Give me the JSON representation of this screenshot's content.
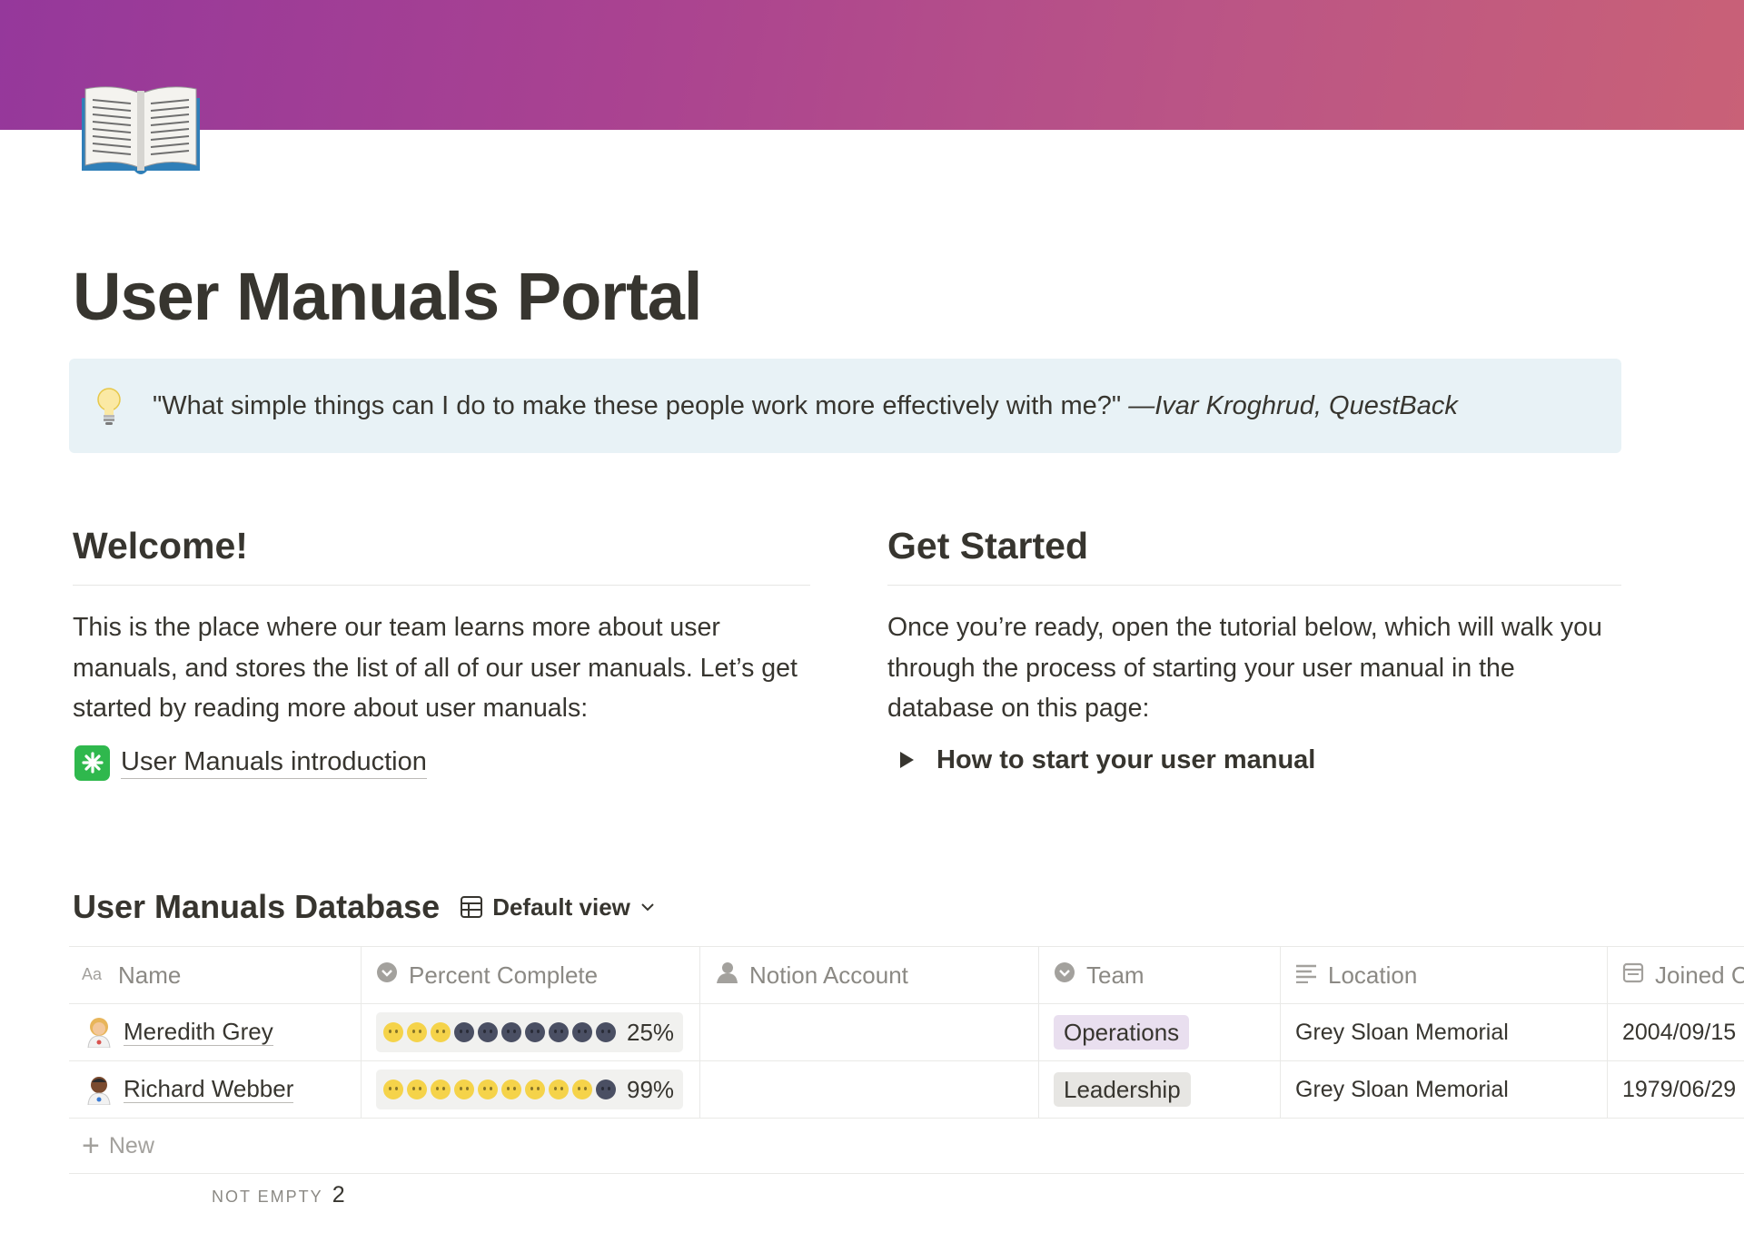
{
  "page": {
    "title": "User Manuals Portal",
    "icon": "open-book-icon"
  },
  "callout": {
    "icon": "light-bulb-icon",
    "quote": "\"What simple things can I do to make these people work more effectively with me?\" ",
    "attribution": "—Ivar Kroghrud, QuestBack"
  },
  "welcome": {
    "heading": "Welcome!",
    "body": "This is the place where our team learns more about user manuals, and stores the list of all of our user manuals. Let’s get started by reading more about user manuals:",
    "link_label": "User Manuals introduction",
    "link_icon": "eight-spoked-asterisk-icon"
  },
  "get_started": {
    "heading": "Get Started",
    "body": "Once you’re ready, open the tutorial below, which will walk you through the process of starting your user manual in the database on this page:",
    "toggle_label": "How to start your user manual"
  },
  "database": {
    "title": "User Manuals Database",
    "view_label": "Default view",
    "columns": [
      "Name",
      "Percent Complete",
      "Notion Account",
      "Team",
      "Location",
      "Joined C"
    ],
    "rows": [
      {
        "name": "Meredith Grey",
        "avatar": "woman-health-worker-icon",
        "progress": 0.25,
        "percent_label": "25%",
        "notion_account": "",
        "team": "Operations",
        "location": "Grey Sloan Memorial",
        "joined": "2004/09/15"
      },
      {
        "name": "Richard Webber",
        "avatar": "man-health-worker-icon",
        "progress": 0.99,
        "percent_label": "99%",
        "notion_account": "",
        "team": "Leadership",
        "location": "Grey Sloan Memorial",
        "joined": "1979/06/29"
      }
    ],
    "new_label": "New",
    "footer": {
      "label": "NOT EMPTY",
      "value": "2"
    }
  },
  "colors": {
    "cover_start": "#95389b",
    "cover_end": "#c96177",
    "callout_bg": "#e8f2f6",
    "tag_operations": "#e9dfef",
    "tag_leadership": "#e7e6e3",
    "progress_lit": "#f5d34a",
    "progress_dark": "#4a4f63"
  }
}
